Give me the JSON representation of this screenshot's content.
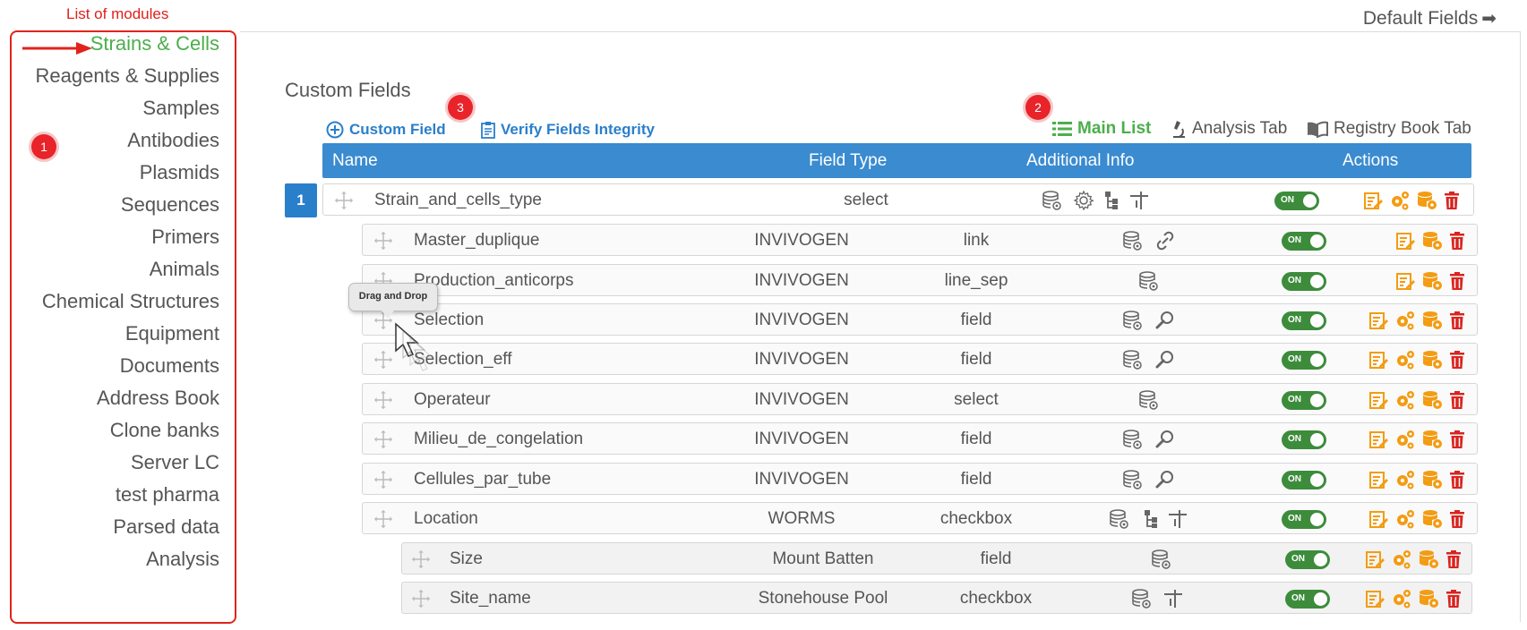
{
  "annotation": {
    "modules_label": "List of modules",
    "badge1": "1",
    "badge2": "2",
    "badge3": "3"
  },
  "default_fields": "Default Fields",
  "modules": [
    {
      "label": "Strains & Cells",
      "active": true
    },
    {
      "label": "Reagents & Supplies"
    },
    {
      "label": "Samples"
    },
    {
      "label": "Antibodies"
    },
    {
      "label": "Plasmids"
    },
    {
      "label": "Sequences"
    },
    {
      "label": "Primers"
    },
    {
      "label": "Animals"
    },
    {
      "label": "Chemical Structures"
    },
    {
      "label": "Equipment"
    },
    {
      "label": "Documents"
    },
    {
      "label": "Address Book"
    },
    {
      "label": "Clone banks"
    },
    {
      "label": "Server LC"
    },
    {
      "label": "test pharma"
    },
    {
      "label": "Parsed data"
    },
    {
      "label": "Analysis"
    }
  ],
  "page_title": "Custom Fields",
  "toolbar": {
    "custom_field": "Custom Field",
    "verify": "Verify Fields Integrity",
    "main_list": "Main List",
    "analysis_tab": "Analysis Tab",
    "registry_tab": "Registry Book Tab"
  },
  "table": {
    "headers": {
      "name": "Name",
      "field_type": "Field Type",
      "additional_info": "Additional Info",
      "actions": "Actions"
    },
    "group_number": "1",
    "toggle_label": "ON",
    "rows": [
      {
        "name": "Strain_and_cells_type",
        "source": "",
        "type": "select"
      },
      {
        "name": "Master_duplique",
        "source": "INVIVOGEN",
        "type": "link"
      },
      {
        "name": "Production_anticorps",
        "source": "INVIVOGEN",
        "type": "line_sep"
      },
      {
        "name": "Selection",
        "source": "INVIVOGEN",
        "type": "field"
      },
      {
        "name": "Selection_eff",
        "source": "INVIVOGEN",
        "type": "field"
      },
      {
        "name": "Operateur",
        "source": "INVIVOGEN",
        "type": "select"
      },
      {
        "name": "Milieu_de_congelation",
        "source": "INVIVOGEN",
        "type": "field"
      },
      {
        "name": "Cellules_par_tube",
        "source": "INVIVOGEN",
        "type": "field"
      },
      {
        "name": "Location",
        "source": "WORMS",
        "type": "checkbox"
      },
      {
        "name": "Size",
        "source": "Mount Batten",
        "type": "field"
      },
      {
        "name": "Site_name",
        "source": "Stonehouse Pool",
        "type": "checkbox"
      }
    ]
  },
  "tooltip": "Drag and Drop",
  "colors": {
    "accent_blue": "#3a8bd0",
    "green": "#4cae4c",
    "orange": "#f39c12",
    "red": "#d9241f",
    "annotation_red": "#e2231a"
  }
}
